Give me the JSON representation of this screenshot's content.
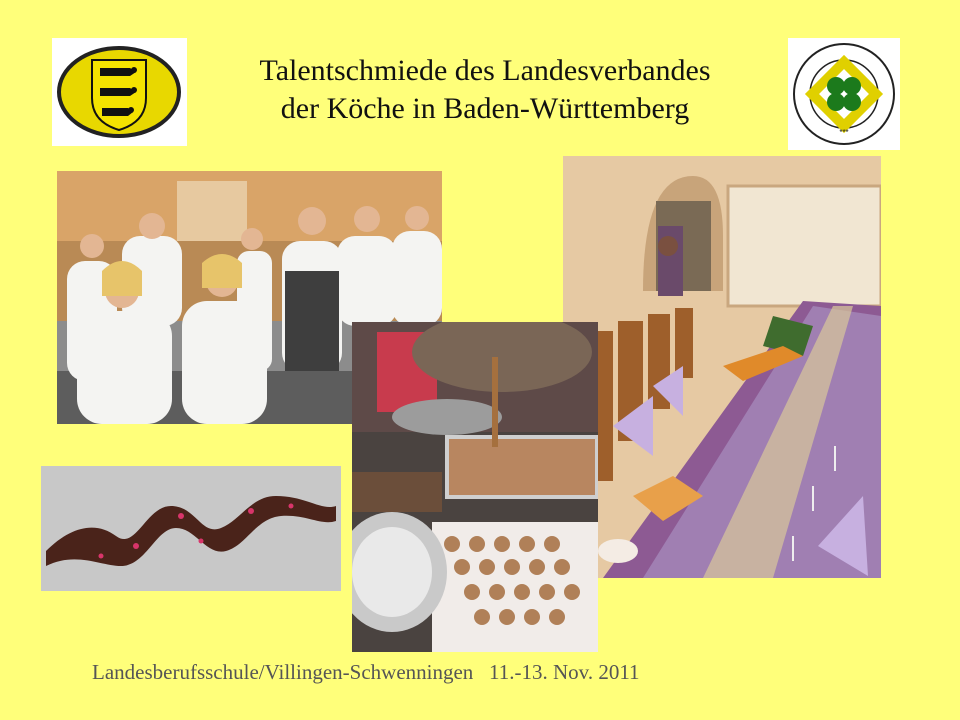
{
  "slide": {
    "title_line1": "Talentschmiede des Landesverbandes",
    "title_line2": "der Köche in Baden-Württemberg",
    "footer": "Landesberufsschule/Villingen-Schwenningen   11.-13. Nov. 2011"
  },
  "logos": {
    "left": {
      "icon": "baden-wuerttemberg-coat-of-arms-icon"
    },
    "right": {
      "icon": "verband-der-koeche-deutschlands-seal-icon",
      "ring_text": "VERBAND DER KÖCHE DEUTSCHLANDS e.V."
    }
  },
  "photos": [
    {
      "name": "kitchen-class-photo",
      "subject": "chefs in white jackets in a training kitchen"
    },
    {
      "name": "banquet-table-photo",
      "subject": "long table with lilac napkins and glasses"
    },
    {
      "name": "chocolate-pouring-photo",
      "subject": "pouring chocolate, chocolate discs on tray"
    },
    {
      "name": "chocolate-ribbon-photo",
      "subject": "twisted chocolate ribbon decoration"
    }
  ],
  "colors": {
    "background": "#ffff7a",
    "title": "#111111",
    "footer": "#555555"
  }
}
